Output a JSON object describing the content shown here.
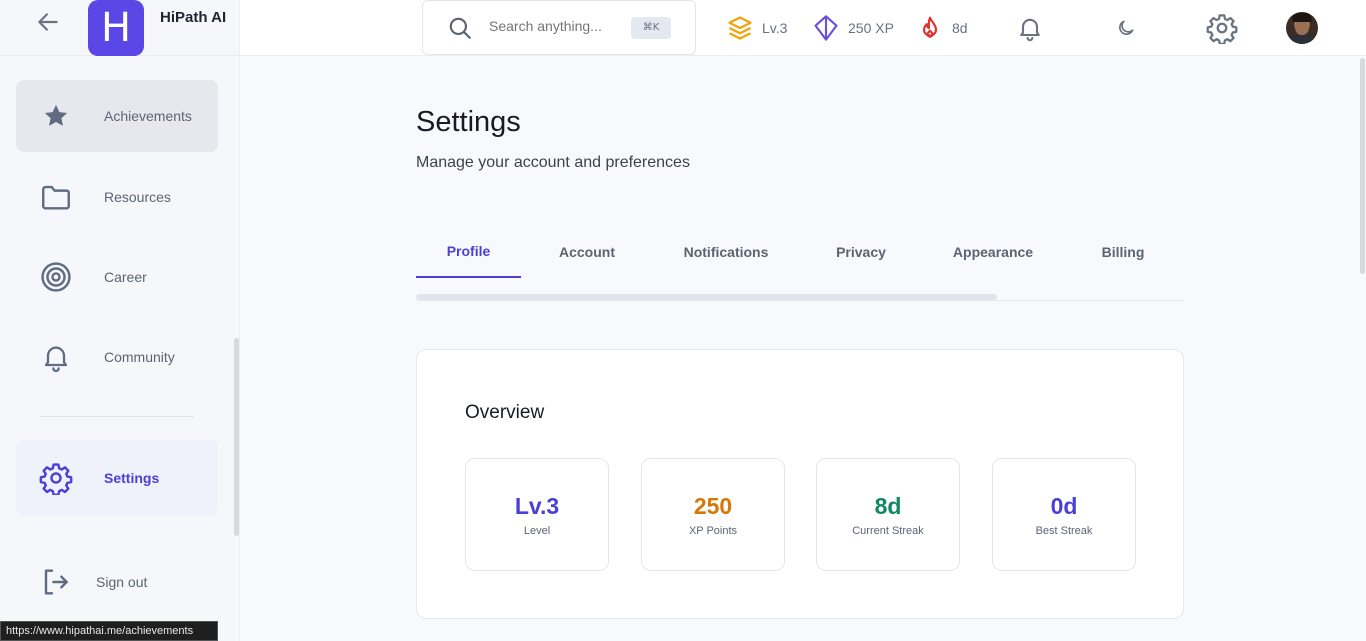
{
  "brand": {
    "name": "HiPath AI",
    "logo_letter": "H"
  },
  "sidebar": {
    "items": [
      {
        "label": "Achievements",
        "icon": "star-icon"
      },
      {
        "label": "Resources",
        "icon": "folder-icon"
      },
      {
        "label": "Career",
        "icon": "target-icon"
      },
      {
        "label": "Community",
        "icon": "bell-icon"
      },
      {
        "label": "Settings",
        "icon": "gear-icon",
        "active": true
      }
    ],
    "signout_label": "Sign out"
  },
  "topbar": {
    "search_placeholder": "Search anything...",
    "search_shortcut": "⌘K",
    "level": "Lv.3",
    "xp": "250 XP",
    "streak": "8d"
  },
  "page": {
    "title": "Settings",
    "subtitle": "Manage your account and preferences"
  },
  "tabs": [
    {
      "label": "Profile",
      "active": true
    },
    {
      "label": "Account"
    },
    {
      "label": "Notifications"
    },
    {
      "label": "Privacy"
    },
    {
      "label": "Appearance"
    },
    {
      "label": "Billing"
    }
  ],
  "overview": {
    "title": "Overview",
    "metrics": [
      {
        "value": "Lv.3",
        "label": "Level",
        "color": "#4b3fd6"
      },
      {
        "value": "250",
        "label": "XP Points",
        "color": "#d97706"
      },
      {
        "value": "8d",
        "label": "Current Streak",
        "color": "#0f8a5f"
      },
      {
        "value": "0d",
        "label": "Best Streak",
        "color": "#4b3fd6"
      }
    ]
  },
  "status_bar": {
    "url": "https://www.hipathai.me/achievements"
  },
  "colors": {
    "accent": "#4b3fd6",
    "brand": "#5b46e6",
    "xp": "#d97706",
    "streak": "#e0322e"
  }
}
